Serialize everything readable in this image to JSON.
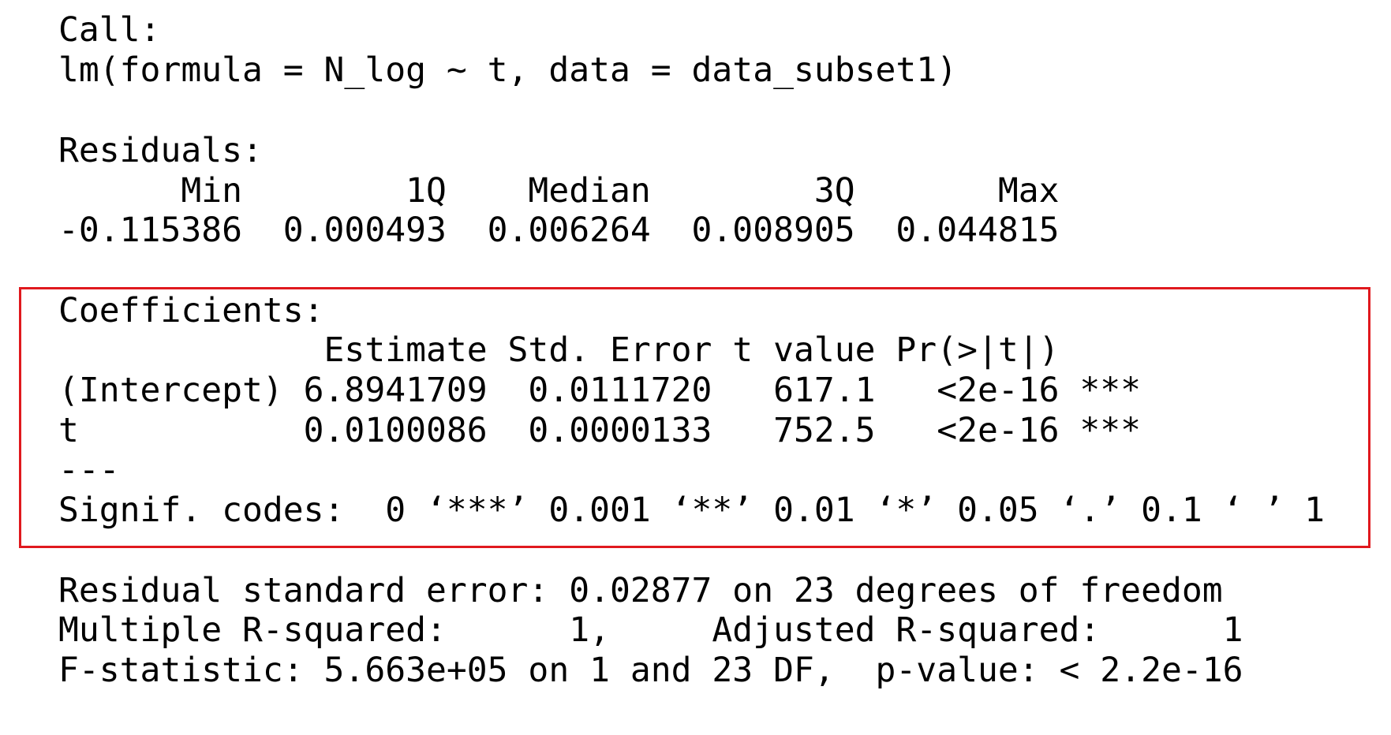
{
  "output": {
    "call_header": "Call:",
    "call_formula": "lm(formula = N_log ~ t, data = data_subset1)",
    "residuals": {
      "header": "Residuals:",
      "labels_row": "      Min        1Q    Median        3Q       Max",
      "values_row": "-0.115386  0.000493  0.006264  0.008905  0.044815"
    },
    "coefficients": {
      "header": "Coefficients:",
      "column_headers": "             Estimate Std. Error t value Pr(>|t|)",
      "rows": [
        "(Intercept) 6.8941709  0.0111720   617.1   <2e-16 ***",
        "t           0.0100086  0.0000133   752.5   <2e-16 ***"
      ],
      "separator": "---",
      "signif_codes": "Signif. codes:  0 ‘***’ 0.001 ‘**’ 0.01 ‘*’ 0.05 ‘.’ 0.1 ‘ ’ 1"
    },
    "summary_lines": [
      "Residual standard error: 0.02877 on 23 degrees of freedom",
      "Multiple R-squared:      1,\tAdjusted R-squared:      1",
      "F-statistic: 5.663e+05 on 1 and 23 DF,  p-value: < 2.2e-16"
    ]
  },
  "colors": {
    "text": "#000000",
    "background": "#ffffff",
    "highlight_border": "#e0191e"
  }
}
